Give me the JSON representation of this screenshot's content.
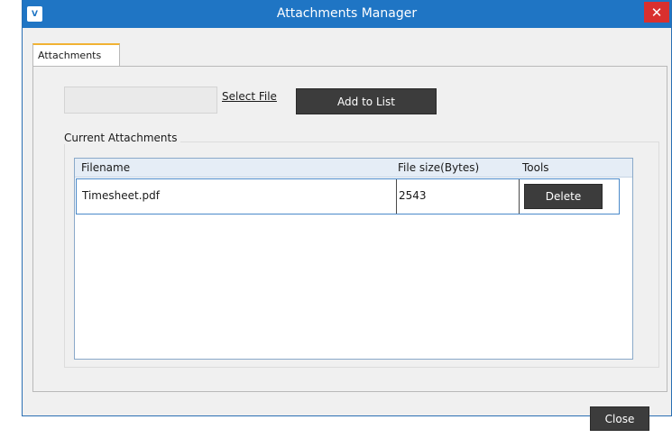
{
  "window": {
    "title": "Attachments Manager",
    "app_icon_text": "V",
    "close_glyph": "✕",
    "icons": [
      "app-logo-icon",
      "close-icon"
    ],
    "colors": {
      "titlebar": "#1f75c4",
      "close_button": "#d9302e",
      "tab_accent": "#f1b233",
      "dark_button": "#3c3c3c"
    }
  },
  "tabs": [
    {
      "label": "Attachments",
      "active": true
    }
  ],
  "file_select": {
    "file_value": "",
    "select_file_link": "Select File",
    "add_button": "Add to List"
  },
  "current_attachments": {
    "legend": "Current Attachments",
    "columns": [
      "Filename",
      "File size(Bytes)",
      "Tools"
    ],
    "rows": [
      {
        "filename": "Timesheet.pdf",
        "size": "2543",
        "action": "Delete"
      }
    ]
  },
  "footer": {
    "close_button": "Close"
  }
}
